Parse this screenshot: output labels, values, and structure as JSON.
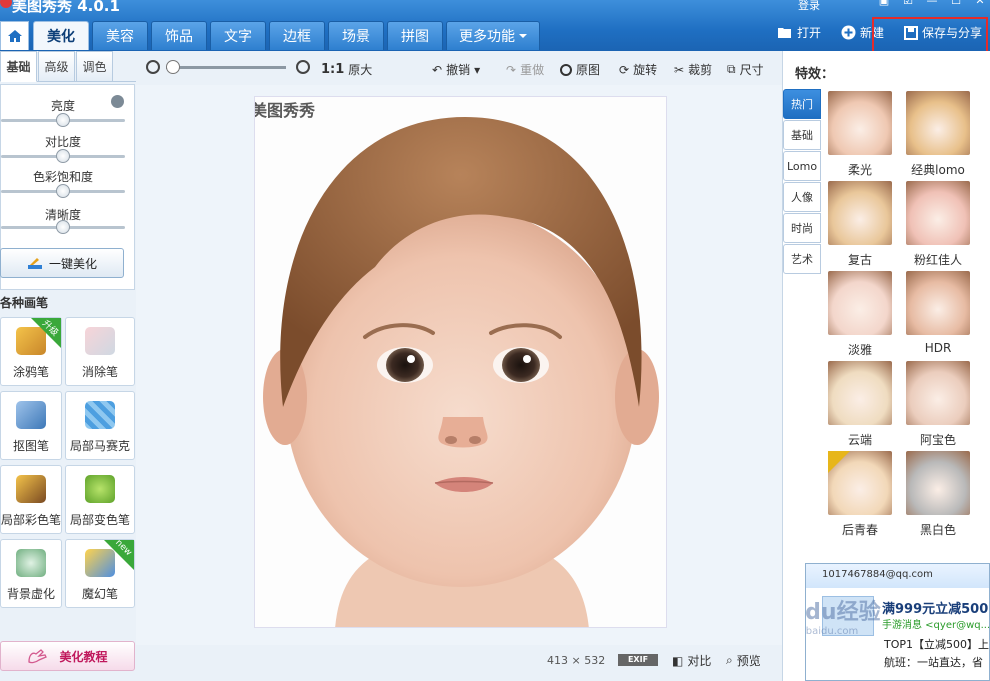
{
  "app": {
    "title": "美图秀秀 4.0.1",
    "login": "登录"
  },
  "tabs": [
    "美化",
    "美容",
    "饰品",
    "文字",
    "边框",
    "场景",
    "拼图",
    "更多功能"
  ],
  "active_tab": "美化",
  "top_actions": {
    "open": "打开",
    "new": "新建",
    "save": "保存与分享"
  },
  "left": {
    "subtabs": [
      "基础",
      "高级",
      "调色"
    ],
    "sliders": [
      {
        "label": "亮度",
        "value": 0.5
      },
      {
        "label": "对比度",
        "value": 0.5
      },
      {
        "label": "色彩饱和度",
        "value": 0.5
      },
      {
        "label": "清晰度",
        "value": 0.5
      }
    ],
    "onekey": "一键美化",
    "brush_title": "各种画笔",
    "brushes": [
      {
        "label": "涂鸦笔",
        "badge": "升级"
      },
      {
        "label": "消除笔",
        "badge": ""
      },
      {
        "label": "抠图笔",
        "badge": ""
      },
      {
        "label": "局部马赛克",
        "badge": ""
      },
      {
        "label": "局部彩色笔",
        "badge": ""
      },
      {
        "label": "局部变色笔",
        "badge": ""
      },
      {
        "label": "背景虚化",
        "badge": ""
      },
      {
        "label": "魔幻笔",
        "badge": "new"
      }
    ],
    "tutorial": "美化教程"
  },
  "toolbar": {
    "zoom_ratio": "1:1",
    "original_size": "原大",
    "undo": "撤销",
    "redo": "重做",
    "original": "原图",
    "rotate": "旋转",
    "crop": "裁剪",
    "size": "尺寸"
  },
  "canvas": {
    "watermark": "美图秀秀",
    "size_w": "413",
    "size_x": "×",
    "size_h": "532",
    "exif": "EXIF",
    "compare": "对比",
    "preview": "预览"
  },
  "right": {
    "title": "特效：",
    "categories": [
      "热门",
      "基础",
      "Lomo",
      "人像",
      "时尚",
      "艺术"
    ],
    "effects": [
      {
        "label": "柔光",
        "tint": "#efc8b2"
      },
      {
        "label": "经典lomo",
        "tint": "#e8c08a"
      },
      {
        "label": "复古",
        "tint": "#e9c79a"
      },
      {
        "label": "粉红佳人",
        "tint": "#f0c1b6"
      },
      {
        "label": "淡雅",
        "tint": "#f3d6cb"
      },
      {
        "label": "HDR",
        "tint": "#e7bba3"
      },
      {
        "label": "云端",
        "tint": "#efdcc0"
      },
      {
        "label": "阿宝色",
        "tint": "#ebcdbd"
      },
      {
        "label": "后青春",
        "tint": "#f2d8b8"
      },
      {
        "label": "黑白色",
        "tint": "#b9b9b9"
      }
    ]
  },
  "popup": {
    "email": "1017467884@qq.com",
    "title": "满999元立减500",
    "sub": "手游消息 <qyer@wq...",
    "line1": "TOP1【立减500】上",
    "line2": "航班：一站直达，省",
    "watermark": "Baidu经验",
    "watermark2": "jingyan.baidu.com"
  },
  "colors": {
    "accent": "#1f6fc2",
    "highlight": "#e52b2b"
  }
}
